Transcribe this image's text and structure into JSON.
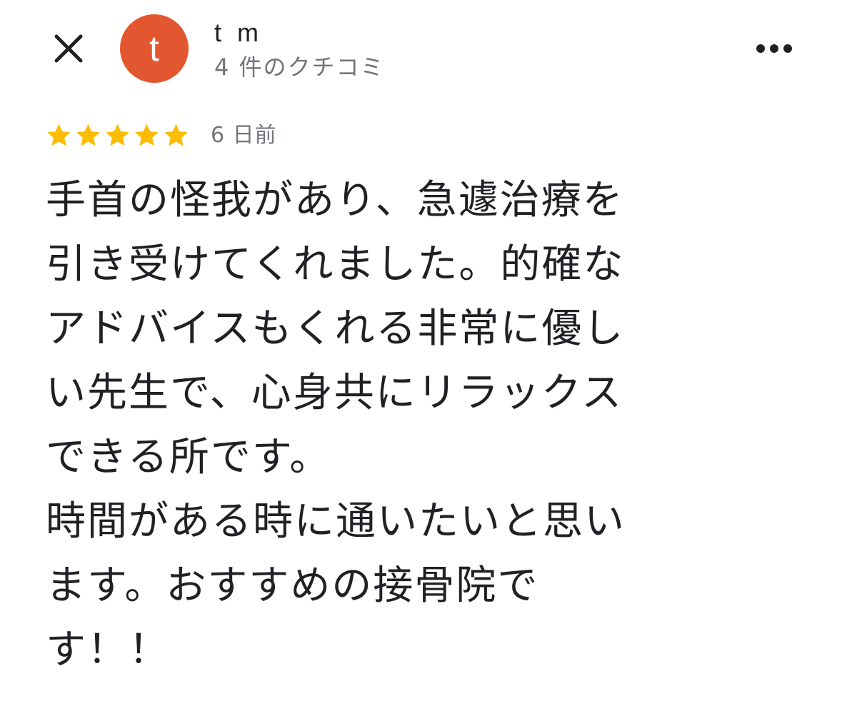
{
  "header": {
    "close_icon": "close-icon",
    "avatar_initial": "t",
    "avatar_color": "#e2572f",
    "user_name": "t m",
    "review_count": "4 件のクチコミ",
    "more_icon": "more-horizontal-icon"
  },
  "review": {
    "rating": 5,
    "rating_max": 5,
    "star_color": "#fbbc04",
    "date": "6 日前",
    "lines": [
      "手首の怪我があり、急遽治療を",
      "引き受けてくれました。的確な",
      "アドバイスもくれる非常に優し",
      "い先生で、心身共にリラックス",
      "できる所です。",
      "時間がある時に通いたいと思い",
      "ます。おすすめの接骨院で",
      "す！！"
    ]
  }
}
